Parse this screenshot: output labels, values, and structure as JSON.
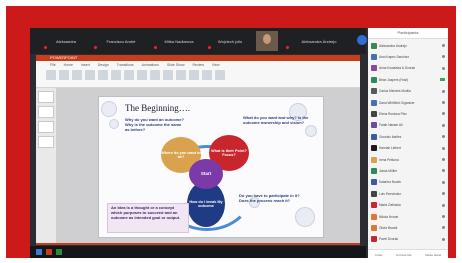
{
  "meeting": {
    "participants": [
      "Aleksandra",
      "Francisco André",
      "Mitka Nadiarova",
      "Wojciech jolls",
      "Aleksandra Ándrejo"
    ],
    "window_title": "POWERPOINT"
  },
  "ppt": {
    "ribbon_tabs": [
      "File",
      "Home",
      "Insert",
      "Design",
      "Transitions",
      "Animations",
      "Slide Show",
      "Review",
      "View"
    ]
  },
  "slide": {
    "title": "The Beginning….",
    "q_top_left": "Why do you want an outcome? Why is the outcome the same as before?",
    "q_top_right": "What do you want and why? Is the outcome ownership and vision?",
    "petal_left": "Where do you want to be?",
    "petal_right": "What is their Point? Focus?",
    "center": "Start",
    "petal_bottom": "How do I break My outcome",
    "q_bottom_right": "Do you have to participate in it? Does the process reach it?",
    "definition": "An Idea is a thought or a concept which purposes to succeed and an outcome as intended goal or output.",
    "colors": {
      "tan": "#d9a24e",
      "red": "#c8262c",
      "purple": "#7c3aa8",
      "navy": "#1f3b84",
      "blue": "#4a8bd6"
    }
  },
  "panel": {
    "header": "Participants",
    "rows": [
      {
        "name": "Aleksandra Ándrejo",
        "color": "#3b8a4a"
      },
      {
        "name": "Ana Krapec Sanchez",
        "color": "#4a6fb0"
      },
      {
        "name": "Anna Kowalska & Dvorak",
        "color": "#8a4a9a"
      },
      {
        "name": "Brian Jaspers (Host)",
        "color": "#2e8b57"
      },
      {
        "name": "Carlos Mendes Morilla",
        "color": "#5a5a5a"
      },
      {
        "name": "Dana Whitfield Organizer",
        "color": "#4a6fb0"
      },
      {
        "name": "Elena Rostova Piec",
        "color": "#444"
      },
      {
        "name": "Farah Nasser Ali",
        "color": "#6b4aa0"
      },
      {
        "name": "Gonzalo Ibañez",
        "color": "#3b5aa0"
      },
      {
        "name": "Hannah Liebert",
        "color": "#1b1b1b"
      },
      {
        "name": "Irena Petkova",
        "color": "#d9a24e"
      },
      {
        "name": "Jonas Müller",
        "color": "#2e8b57"
      },
      {
        "name": "Katarina Novak",
        "color": "#3b5aa0"
      },
      {
        "name": "Luis Fernández",
        "color": "#444"
      },
      {
        "name": "Marta Zielinska",
        "color": "#c8262c"
      },
      {
        "name": "Nikola Horvat",
        "color": "#d9783a"
      },
      {
        "name": "Olivia Brandt",
        "color": "#d9783a"
      },
      {
        "name": "Pavel Dvorak",
        "color": "#c8262c"
      }
    ],
    "footer": [
      "Invite",
      "Unmute Me",
      "Raise Hand"
    ]
  }
}
